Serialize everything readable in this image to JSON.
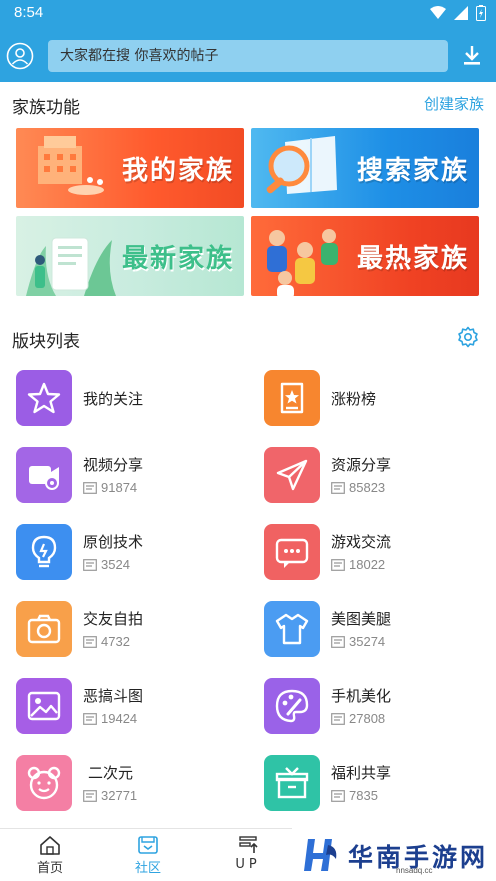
{
  "status_bar": {
    "time": "8:54"
  },
  "header": {
    "search_placeholder": "大家都在搜  你喜欢的帖子"
  },
  "family": {
    "title": "家族功能",
    "create_link": "创建家族",
    "banners": [
      {
        "label": "我的家族"
      },
      {
        "label": "搜索家族"
      },
      {
        "label": "最新家族"
      },
      {
        "label": "最热家族"
      }
    ]
  },
  "boards": {
    "title": "版块列表",
    "items": [
      {
        "name": "我的关注",
        "count": "",
        "color": "#9b5de5",
        "icon": "star-icon"
      },
      {
        "name": "涨粉榜",
        "count": "",
        "color": "#f7862f",
        "icon": "ranking-icon"
      },
      {
        "name": "视频分享",
        "count": "91874",
        "color": "#a366e6",
        "icon": "video-icon"
      },
      {
        "name": "资源分享",
        "count": "85823",
        "color": "#f0656a",
        "icon": "send-icon"
      },
      {
        "name": "原创技术",
        "count": "3524",
        "color": "#3d8ff0",
        "icon": "bulb-icon"
      },
      {
        "name": "游戏交流",
        "count": "18022",
        "color": "#f06262",
        "icon": "chat-icon"
      },
      {
        "name": "交友自拍",
        "count": "4732",
        "color": "#f8a04a",
        "icon": "camera-icon"
      },
      {
        "name": "美图美腿",
        "count": "35274",
        "color": "#4b9cf2",
        "icon": "shirt-icon"
      },
      {
        "name": "恶搞斗图",
        "count": "19424",
        "color": "#a65ee6",
        "icon": "image-icon"
      },
      {
        "name": "手机美化",
        "count": "27808",
        "color": "#9a62e8",
        "icon": "palette-icon"
      },
      {
        "name": "二次元",
        "count": "32771",
        "color": "#f47fa4",
        "icon": "bear-icon"
      },
      {
        "name": "福利共享",
        "count": "7835",
        "color": "#2fc3a6",
        "icon": "gift-icon"
      }
    ]
  },
  "bottom_nav": [
    {
      "label": "首页"
    },
    {
      "label": "社区"
    },
    {
      "label": "UP"
    }
  ],
  "watermark": {
    "text": "华南手游网",
    "url": "hnsadq.cc"
  },
  "colors": {
    "primary": "#2ea3e0"
  }
}
